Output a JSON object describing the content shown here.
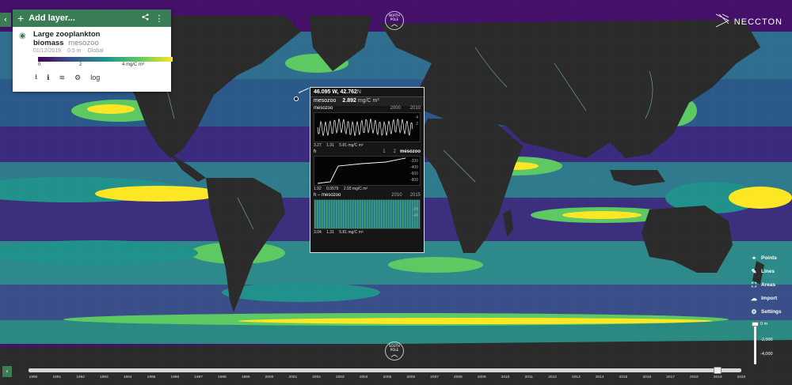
{
  "panel": {
    "add_layer_label": "Add layer...",
    "layer_name": "Large zooplankton",
    "layer_name_line2": "biomass",
    "layer_code": "mesozoo",
    "date": "01/12/2019",
    "depth": "0.5 m",
    "region": "Global",
    "colorbar_ticks": [
      "0",
      "2",
      "4 mg/C m³"
    ],
    "log_label": "log",
    "icons": {
      "share": "share-icon",
      "more": "more-vert-icon",
      "visibility": "eye-icon",
      "download": "download-icon",
      "info": "info-icon",
      "layers": "layers-icon",
      "settings": "gear-icon"
    }
  },
  "logo": {
    "text": "NECCTON"
  },
  "poles": {
    "north_label": "NORTH POLE",
    "south_label": "SOUTH POLE"
  },
  "popup": {
    "coords_lon": "46.095 W, ",
    "coords_lat": "42.762",
    "coords_n": "N",
    "variable": "mesozoo",
    "value": "2.892",
    "unit": "mg/C m³",
    "timeseries": {
      "label": "mesozoo",
      "x_ticks": [
        "2000",
        "2010"
      ],
      "y_ticks": [
        "4",
        "2"
      ],
      "stats": [
        "3.27",
        "1.31",
        "5.81 mg/C m³"
      ]
    },
    "profile": {
      "label": "h",
      "label_right": "mesozoo",
      "x_ticks": [
        "1",
        "2"
      ],
      "y_ticks": [
        "-200",
        "-400",
        "-600",
        "-800"
      ],
      "stats": [
        "1.92",
        "0.0579",
        "2.93 mg/C m³"
      ]
    },
    "hovmoller": {
      "label": "h – mesozoo",
      "x_ticks": [
        "2010",
        "2015"
      ],
      "y_ticks": [
        "-20",
        "-40"
      ],
      "stats": [
        "3.04",
        "1.31",
        "5.81 mg/C m³"
      ]
    }
  },
  "toolbar": {
    "items": [
      {
        "label": "Points",
        "icon": "crosshair-icon"
      },
      {
        "label": "Lines",
        "icon": "pencil-icon"
      },
      {
        "label": "Areas",
        "icon": "area-icon"
      },
      {
        "label": "Import",
        "icon": "cloud-upload-icon"
      },
      {
        "label": "Settings",
        "icon": "gear-icon"
      }
    ],
    "depth_labels": [
      "0 m",
      "-2,000",
      "-4,000"
    ]
  },
  "timeline": {
    "years": [
      "1990",
      "1991",
      "1992",
      "1993",
      "1994",
      "1995",
      "1996",
      "1997",
      "1998",
      "1999",
      "2000",
      "2001",
      "2002",
      "2003",
      "2004",
      "2005",
      "2006",
      "2007",
      "2008",
      "2009",
      "2010",
      "2011",
      "2012",
      "2013",
      "2014",
      "2015",
      "2016",
      "2017",
      "2018",
      "2019",
      "2020"
    ],
    "selected_year": "2019"
  },
  "colors": {
    "accent": "#3a7d55",
    "land": "#2b2b2b",
    "low": "#440154",
    "high": "#fde725"
  }
}
